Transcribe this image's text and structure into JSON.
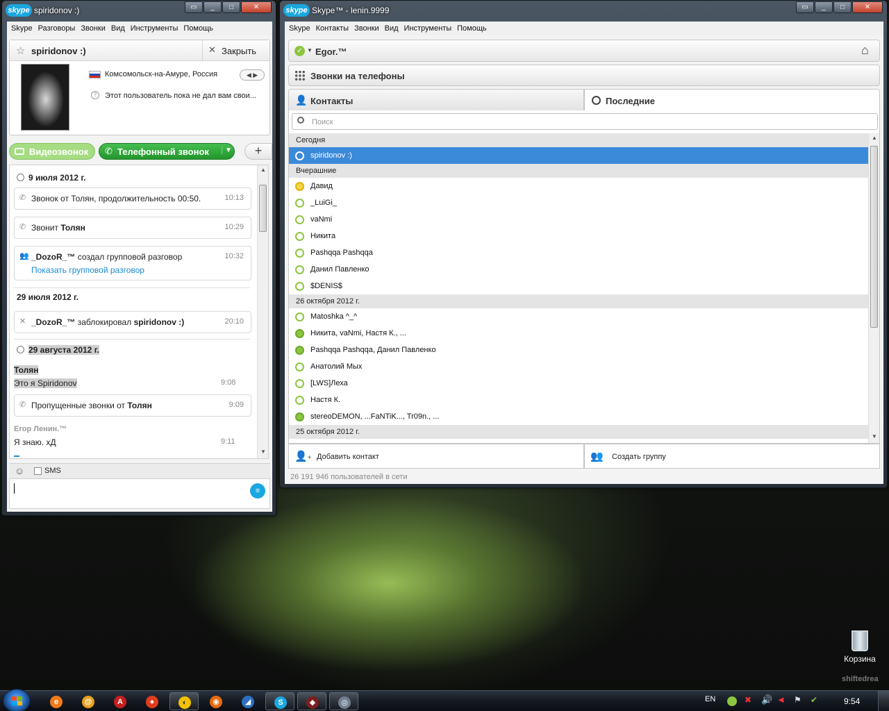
{
  "chat_window": {
    "title": "spiridonov :)",
    "menu": [
      "Skype",
      "Разговоры",
      "Звонки",
      "Вид",
      "Инструменты",
      "Помощь"
    ],
    "contact_name": "spiridonov :)",
    "close_label": "Закрыть",
    "location": "Комсомольск-на-Амуре, Россия",
    "mood": "Этот пользователь пока не дал вам свои...",
    "video_call_label": "Видеозвонок",
    "phone_call_label": "Телефонный звонок",
    "history": {
      "date1": "9 июля 2012 г.",
      "call1_text": "Звонок от Толян, продолжительность 00:50.",
      "call1_time": "10:13",
      "call2_prefix": "Звонит",
      "call2_name": "Толян",
      "call2_time": "10:29",
      "group_user": "_DozoR_™",
      "group_text": "создал групповой разговор",
      "group_link": "Показать групповой разговор",
      "group_time": "10:32",
      "date2": "29 июля 2012 г.",
      "block_user": "_DozoR_™",
      "block_text": "заблокировал",
      "block_target": "spiridonov :)",
      "block_time": "20:10",
      "date3": "29 августа 2012 г.",
      "msg1_author": "Толян",
      "msg1_text": "Это я Spiridonov",
      "msg1_time": "9:08",
      "missed_prefix": "Пропущенные звонки от",
      "missed_name": "Толян",
      "missed_time": "9:09",
      "msg2_author": "Егор Ленин.™",
      "msg2_text": "Я знаю. хД",
      "msg2_time": "9:11"
    },
    "sms_label": "SMS",
    "input_value": ""
  },
  "main_window": {
    "title": "Skype™ - lenin.9999",
    "menu": [
      "Skype",
      "Контакты",
      "Звонки",
      "Вид",
      "Инструменты",
      "Помощь"
    ],
    "user_name": "Egor.™",
    "phone_calls_label": "Звонки на телефоны",
    "tab_contacts": "Контакты",
    "tab_recent": "Последние",
    "search_placeholder": "Поиск",
    "groups": [
      {
        "header": "Сегодня",
        "items": [
          {
            "name": "spiridonov :)",
            "status": "sel"
          }
        ]
      },
      {
        "header": "Вчерашние",
        "items": [
          {
            "name": "Давид",
            "status": "away"
          },
          {
            "name": "_LuiGi_",
            "status": "online"
          },
          {
            "name": "vaNmi",
            "status": "online"
          },
          {
            "name": "Никита",
            "status": "online"
          },
          {
            "name": "Pashqqa Pashqqa",
            "status": "online"
          },
          {
            "name": "Данил Павленко",
            "status": "online"
          },
          {
            "name": "$DENIS$",
            "status": "online"
          }
        ]
      },
      {
        "header": "26 октября 2012 г.",
        "items": [
          {
            "name": "Matoshka ^_^",
            "status": "online"
          },
          {
            "name": "Никита, vaNmi, Настя К., ...",
            "status": "grp"
          },
          {
            "name": "Pashqqa Pashqqa, Данил Павленко",
            "status": "grp"
          },
          {
            "name": "Анатолий Мых",
            "status": "online"
          },
          {
            "name": "[LWS]Леха",
            "status": "online"
          },
          {
            "name": "Настя К.",
            "status": "online"
          },
          {
            "name": "stereoDEMON, ...FaNTiK..., Tr09n., ...",
            "status": "grp"
          }
        ]
      },
      {
        "header": "25 октября 2012 г.",
        "items": []
      }
    ],
    "add_contact_label": "Добавить контакт",
    "create_group_label": "Создать группу",
    "status_line": "26 191 946 пользователей в сети"
  },
  "desktop": {
    "recycle_bin_label": "Корзина",
    "watermark": "shiftedrea"
  },
  "taskbar": {
    "lang": "EN",
    "clock": "9:54"
  },
  "colors": {
    "skype_blue": "#1aa7e0",
    "online_green": "#8cc63f",
    "video_button": "#9fd77a",
    "phone_button": "#2fa53a",
    "selected_row": "#3b8ad9"
  }
}
